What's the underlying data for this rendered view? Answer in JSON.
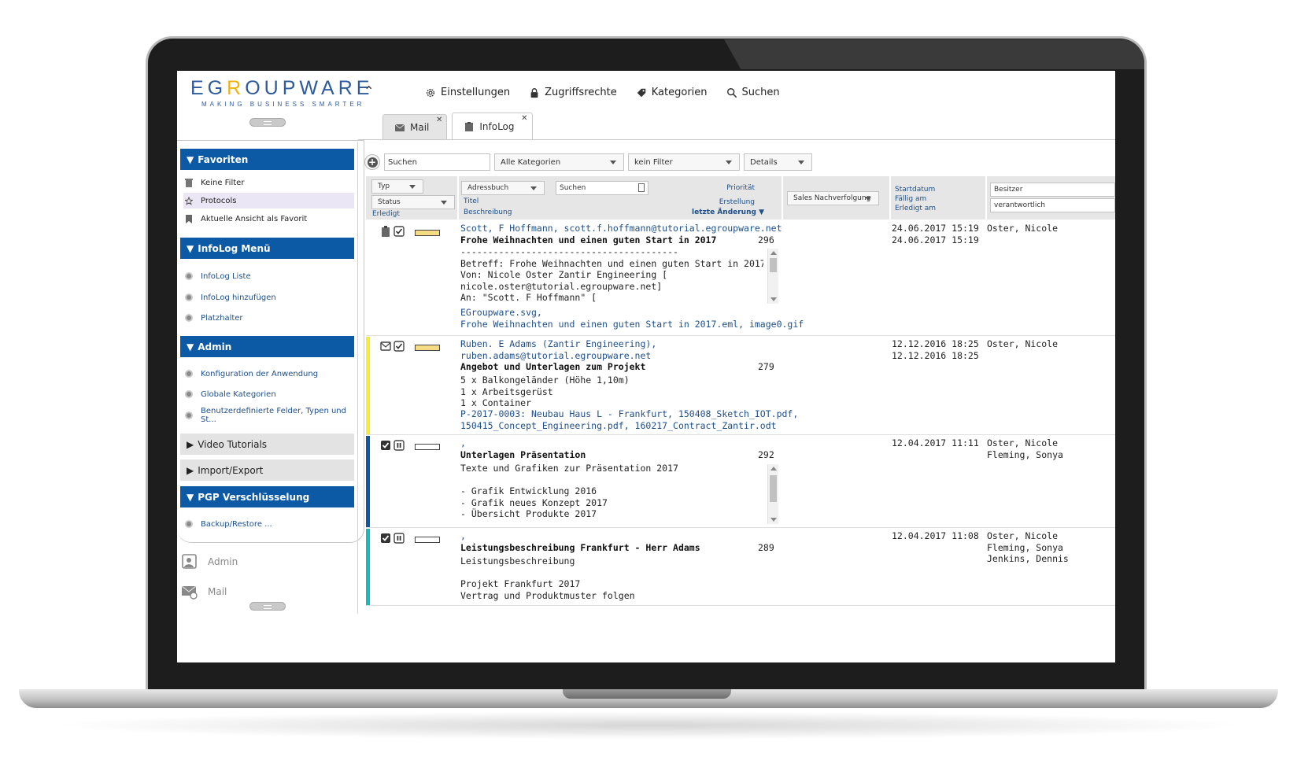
{
  "header": {
    "logo_prefix": "EG",
    "logo_highlight": "R",
    "logo_rest": "OUPWARE",
    "logo_tagline": "MAKING BUSINESS SMARTER",
    "nav": [
      {
        "label": "Einstellungen",
        "icon": "gear-icon"
      },
      {
        "label": "Zugriffsrechte",
        "icon": "lock-icon"
      },
      {
        "label": "Kategorien",
        "icon": "tag-icon"
      },
      {
        "label": "Suchen",
        "icon": "search-icon"
      }
    ]
  },
  "tabs": [
    {
      "label": "Mail",
      "icon": "mail-icon",
      "active": false
    },
    {
      "label": "InfoLog",
      "icon": "clipboard-icon",
      "active": true
    }
  ],
  "sidebar": {
    "favoriten": {
      "title": "Favoriten",
      "items": [
        "Keine Filter",
        "Protocols",
        "Aktuelle Ansicht als Favorit"
      ]
    },
    "infolog_menu": {
      "title": "InfoLog Menü",
      "items": [
        "InfoLog Liste",
        "InfoLog hinzufügen",
        "Platzhalter"
      ]
    },
    "admin": {
      "title": "Admin",
      "items": [
        "Konfiguration der Anwendung",
        "Globale Kategorien",
        "Benutzerdefinierte Felder, Typen und St..."
      ]
    },
    "video": {
      "title": "Video Tutorials"
    },
    "import": {
      "title": "Import/Export"
    },
    "pgp": {
      "title": "PGP Verschlüsselung",
      "items": [
        "Backup/Restore ..."
      ]
    },
    "apps": [
      {
        "label": "Admin",
        "icon": "admin-icon"
      },
      {
        "label": "Mail",
        "icon": "mail-app-icon"
      }
    ]
  },
  "toolbar": {
    "search_placeholder": "Suchen",
    "category": "Alle Kategorien",
    "filter": "kein Filter",
    "view": "Details"
  },
  "columns": {
    "typ": "Typ",
    "status": "Status",
    "erledigt": "Erledigt",
    "adressbuch": "Adressbuch",
    "suchen": "Suchen",
    "prioritaet": "Priorität",
    "titel": "Titel",
    "erstellung": "Erstellung",
    "beschreibung": "Beschreibung",
    "letzte_aenderung": "letzte Änderung ▼",
    "sales": "Sales Nachverfolgung",
    "startdatum": "Startdatum",
    "faellig": "Fällig am",
    "erledigt_am": "Erledigt am",
    "besitzer": "Besitzer",
    "verantwortlich": "verantwortlich"
  },
  "rows": [
    {
      "bar_color": "#ffffff",
      "progress_fill": "#f5dc84",
      "contact": "Scott, F Hoffmann, scott.f.hoffmann@tutorial.egroupware.net",
      "title": "Frohe Weihnachten und einen guten Start in 2017",
      "id": "296",
      "desc": "----------------------------------------\nBetreff: Frohe Weihnachten und einen guten Start in 2017\nVon: Nicole Oster Zantir Engineering [\nnicole.oster@tutorial.egroupware.net]\nAn: \"Scott. F Hoffmann\" [",
      "attachments": "EGroupware.svg,\nFrohe Weihnachten und einen guten Start in 2017.eml, image0.gif",
      "dates": "24.06.2017 15:19\n24.06.2017 15:19",
      "owners": "Oster, Nicole"
    },
    {
      "bar_color": "#f6ec3b",
      "progress_fill": "#f5dc84",
      "contact": "Ruben. E Adams (Zantir Engineering),\nruben.adams@tutorial.egroupware.net",
      "title": "Angebot und Unterlagen zum Projekt",
      "id": "279",
      "desc": "5 x Balkongeländer (Höhe 1,10m)\n1 x Arbeitsgerüst\n1 x Container",
      "attachments": "P-2017-0003: Neubau Haus L - Frankfurt, 150408_Sketch_IOT.pdf,\n150415_Concept_Engineering.pdf, 160217_Contract_Zantir.odt",
      "dates": "12.12.2016 18:25\n12.12.2016 18:25",
      "owners": "Oster, Nicole"
    },
    {
      "bar_color": "#0d56a8",
      "progress_fill": "#ffffff",
      "contact": ",",
      "title": "Unterlagen Präsentation",
      "id": "292",
      "desc": "Texte und Grafiken zur Präsentation 2017\n\n- Grafik Entwicklung 2016\n- Grafik neues Konzept 2017\n- Übersicht Produkte 2017",
      "attachments": "",
      "dates": "12.04.2017 11:11",
      "owners": "Oster, Nicole\nFleming, Sonya"
    },
    {
      "bar_color": "#18b8c4",
      "progress_fill": "#ffffff",
      "contact": ",",
      "title": "Leistungsbeschreibung Frankfurt - Herr Adams",
      "id": "289",
      "desc": "Leistungsbeschreibung\n\nProjekt Frankfurt 2017\nVertrag und Produktmuster folgen",
      "attachments": "",
      "dates": "12.04.2017 11:08",
      "owners": "Oster, Nicole\nFleming, Sonya\nJenkins, Dennis"
    }
  ]
}
